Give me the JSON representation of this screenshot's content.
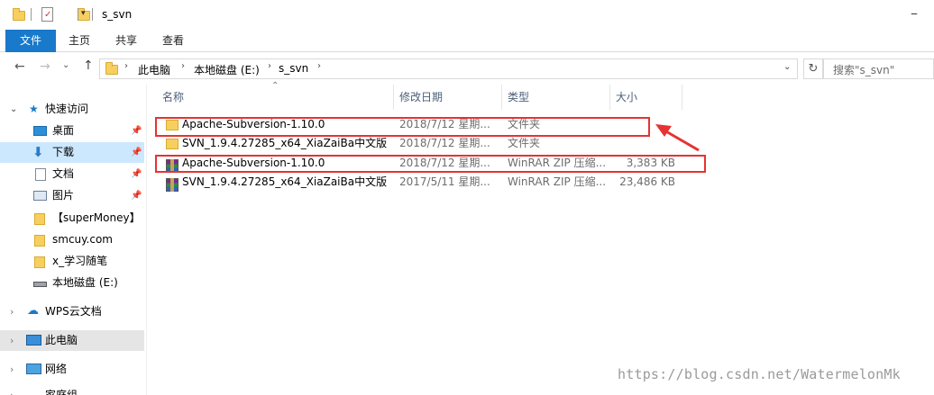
{
  "window": {
    "title": "s_svn"
  },
  "ribbon": {
    "tabs": [
      "文件",
      "主页",
      "共享",
      "查看"
    ]
  },
  "address": {
    "crumbs": [
      "此电脑",
      "本地磁盘 (E:)",
      "s_svn"
    ]
  },
  "search": {
    "placeholder": "搜索\"s_svn\""
  },
  "nav": {
    "quick_access": "快速访问",
    "items": [
      "桌面",
      "下载",
      "文档",
      "图片",
      "【superMoney】",
      "smcuy.com",
      "x_学习随笔",
      "本地磁盘 (E:)"
    ],
    "wps": "WPS云文档",
    "this_pc": "此电脑",
    "network": "网络",
    "homegroup": "家庭组"
  },
  "columns": {
    "name": "名称",
    "date": "修改日期",
    "type": "类型",
    "size": "大小"
  },
  "files": [
    {
      "name": "Apache-Subversion-1.10.0",
      "date": "2018/7/12 星期...",
      "type": "文件夹",
      "size": "",
      "icon": "folder-icon"
    },
    {
      "name": "SVN_1.9.4.27285_x64_XiaZaiBa中文版",
      "date": "2018/7/12 星期...",
      "type": "文件夹",
      "size": "",
      "icon": "folder-icon"
    },
    {
      "name": "Apache-Subversion-1.10.0",
      "date": "2018/7/12 星期...",
      "type": "WinRAR ZIP 压缩...",
      "size": "3,383 KB",
      "icon": "winrar-zip-icon"
    },
    {
      "name": "SVN_1.9.4.27285_x64_XiaZaiBa中文版",
      "date": "2017/5/11 星期...",
      "type": "WinRAR ZIP 压缩...",
      "size": "23,486 KB",
      "icon": "winrar-zip-icon"
    }
  ],
  "watermark": "https://blog.csdn.net/WatermelonMk",
  "colors": {
    "accent": "#1979ca",
    "highlight": "#e53333",
    "selected": "#cce8ff"
  }
}
